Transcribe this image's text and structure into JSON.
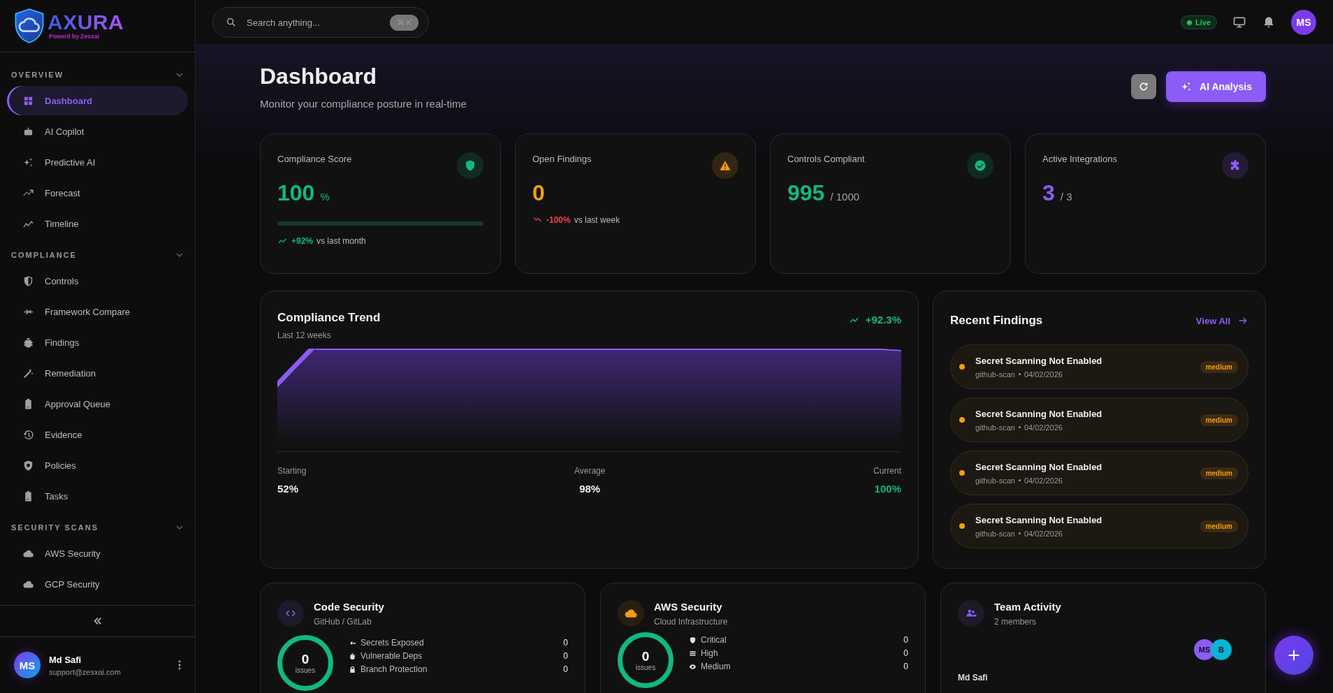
{
  "brand": {
    "name": "AXURA",
    "tagline": "Powerd by Zesxai"
  },
  "sidebar": {
    "sections": [
      {
        "title": "OVERVIEW",
        "expanded": true,
        "items": [
          {
            "label": "Dashboard",
            "selected": true
          },
          {
            "label": "AI Copilot",
            "selected": false
          },
          {
            "label": "Predictive AI",
            "selected": false
          },
          {
            "label": "Forecast",
            "selected": false
          },
          {
            "label": "Timeline",
            "selected": false
          }
        ]
      },
      {
        "title": "COMPLIANCE",
        "expanded": true,
        "items": [
          {
            "label": "Controls",
            "selected": false
          },
          {
            "label": "Framework Compare",
            "selected": false
          },
          {
            "label": "Findings",
            "selected": false
          },
          {
            "label": "Remediation",
            "selected": false
          },
          {
            "label": "Approval Queue",
            "selected": false
          },
          {
            "label": "Evidence",
            "selected": false
          },
          {
            "label": "Policies",
            "selected": false
          },
          {
            "label": "Tasks",
            "selected": false
          }
        ]
      },
      {
        "title": "SECURITY SCANS",
        "expanded": true,
        "items": [
          {
            "label": "AWS Security",
            "selected": false
          },
          {
            "label": "GCP Security",
            "selected": false
          }
        ]
      }
    ],
    "user": {
      "initials": "MS",
      "name": "Md Safi",
      "email": "support@zesxai.com"
    }
  },
  "header": {
    "search": {
      "placeholder": "Search anything...",
      "shortcut": "⌘ K"
    },
    "status": "Live",
    "avatar": "MS"
  },
  "page": {
    "title": "Dashboard",
    "subtitle": "Monitor your compliance posture in real-time",
    "primary_button": "AI Analysis"
  },
  "stats": [
    {
      "label": "Compliance Score",
      "value": "100",
      "unit": "%",
      "color": "#10b981",
      "level": 1,
      "trend": {
        "kind": "up",
        "change": "+92%",
        "note": "vs last month"
      }
    },
    {
      "label": "Open Findings",
      "value": "0",
      "color": "#f59e0b",
      "trend": {
        "kind": "down",
        "change": "-100%",
        "note": "vs last week"
      }
    },
    {
      "label": "Controls Compliant",
      "value": "995",
      "unit": "/ 1000",
      "color": "#10b981"
    },
    {
      "label": "Active Integrations",
      "value": "3",
      "unit": "/ 3",
      "color": "#8b5cf6"
    }
  ],
  "trend": {
    "title": "Compliance Trend",
    "subtitle": "Last 12 weeks",
    "change": "+92.3%",
    "summary": [
      {
        "label": "Starting",
        "value": "52%"
      },
      {
        "label": "Average",
        "value": "98%"
      },
      {
        "label": "Current",
        "value": "100%"
      }
    ]
  },
  "findings": {
    "title": "Recent Findings",
    "link": "View All",
    "items": [
      {
        "title": "Secret Scanning Not Enabled",
        "source": "github-scan",
        "date": "04/02/2026",
        "severity": "medium",
        "color": "#f59e0b"
      },
      {
        "title": "Secret Scanning Not Enabled",
        "source": "github-scan",
        "date": "04/02/2026",
        "severity": "medium",
        "color": "#f59e0b"
      },
      {
        "title": "Secret Scanning Not Enabled",
        "source": "github-scan",
        "date": "04/02/2026",
        "severity": "medium",
        "color": "#f59e0b"
      },
      {
        "title": "Secret Scanning Not Enabled",
        "source": "github-scan",
        "date": "04/02/2026",
        "severity": "medium",
        "color": "#f59e0b"
      }
    ]
  },
  "scans": [
    {
      "kind": "scan",
      "title": "Code Security",
      "subtitle": "GitHub / GitLab",
      "count": "0",
      "count_label": "issues",
      "rows": [
        {
          "label": "Secrets Exposed",
          "value": "0"
        },
        {
          "label": "Vulnerable Deps",
          "value": "0"
        },
        {
          "label": "Branch Protection",
          "value": "0"
        }
      ]
    },
    {
      "kind": "scan",
      "title": "AWS Security",
      "subtitle": "Cloud Infrastructure",
      "count": "0",
      "count_label": "issues",
      "rows": [
        {
          "label": "Critical",
          "value": "0"
        },
        {
          "label": "High",
          "value": "0"
        },
        {
          "label": "Medium",
          "value": "0"
        }
      ]
    },
    {
      "kind": "team",
      "title": "Team Activity",
      "subtitle": "2 members",
      "members": [
        "MS",
        "B"
      ],
      "member_name": "Md Safi"
    }
  ]
}
